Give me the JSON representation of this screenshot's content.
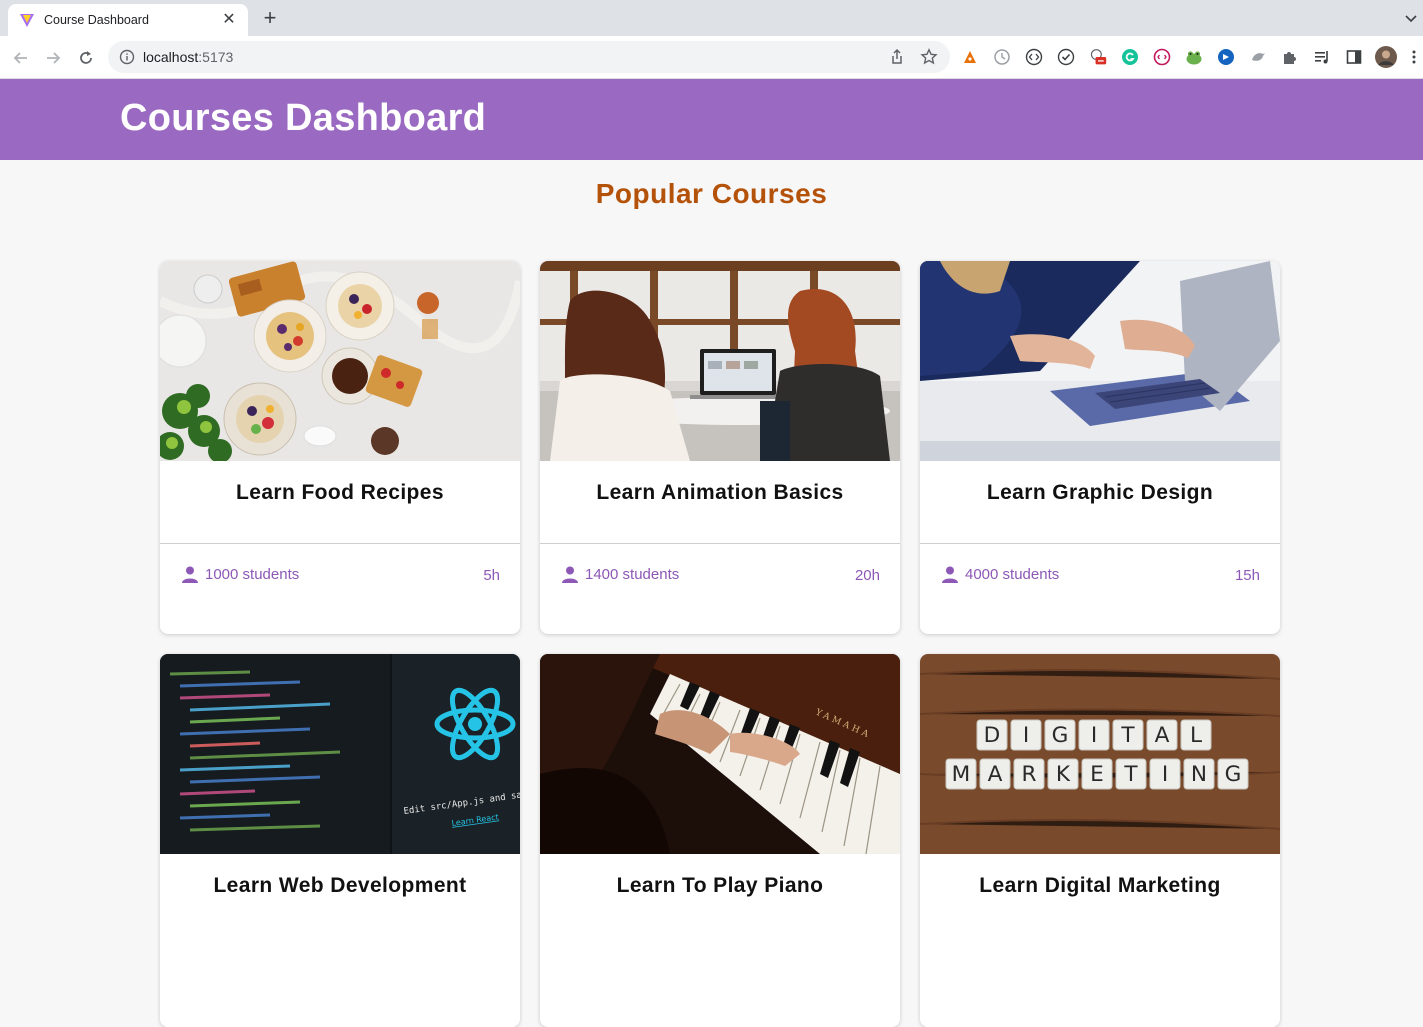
{
  "browser": {
    "tab_title": "Course Dashboard",
    "url_host": "localhost",
    "url_port": ":5173"
  },
  "header": {
    "title": "Courses Dashboard",
    "background_color": "#9a6ac2"
  },
  "section": {
    "title": "Popular Courses",
    "title_color": "#b5520a"
  },
  "courses": [
    {
      "title": "Learn Food Recipes",
      "students": "1000 students",
      "duration": "5h",
      "image": "food-bowls-photo"
    },
    {
      "title": "Learn Animation Basics",
      "students": "1400 students",
      "duration": "20h",
      "image": "people-at-laptop-photo"
    },
    {
      "title": "Learn Graphic Design",
      "students": "4000 students",
      "duration": "15h",
      "image": "hands-on-laptop-photo"
    },
    {
      "title": "Learn Web Development",
      "students": "",
      "duration": "",
      "image": "react-code-editor-photo"
    },
    {
      "title": "Learn To Play Piano",
      "students": "",
      "duration": "",
      "image": "piano-keys-photo"
    },
    {
      "title": "Learn Digital Marketing",
      "students": "",
      "duration": "",
      "image": "digital-marketing-tiles-photo"
    }
  ],
  "image_text": {
    "react_caption": "Edit src/App.js and save to reload.",
    "react_link": "Learn React",
    "piano_brand": "YAMAHA",
    "tiles_row1": [
      "D",
      "I",
      "G",
      "I",
      "T",
      "A",
      "L"
    ],
    "tiles_row2": [
      "M",
      "A",
      "R",
      "K",
      "E",
      "T",
      "I",
      "N",
      "G"
    ]
  },
  "accent_color": "#8d58b6"
}
